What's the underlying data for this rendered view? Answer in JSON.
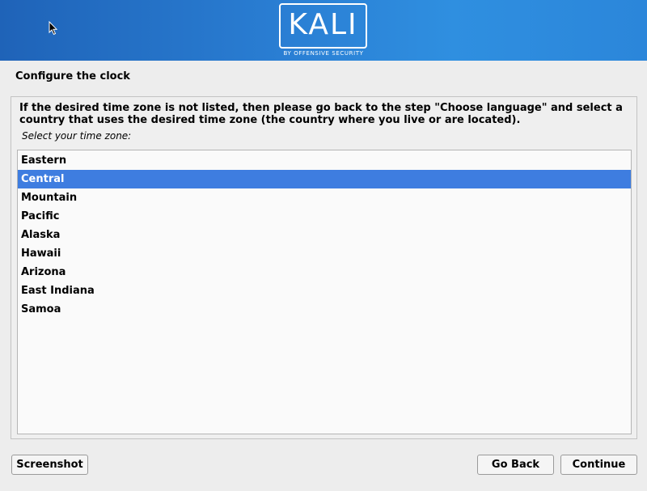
{
  "banner": {
    "logo_text": "KALI",
    "logo_subtext": "BY OFFENSIVE SECURITY"
  },
  "page_title": "Configure the clock",
  "description": "If the desired time zone is not listed, then please go back to the step \"Choose language\" and select a country that uses the desired time zone (the country where you live or are located).",
  "prompt": "Select your time zone:",
  "timezones": [
    {
      "label": "Eastern",
      "selected": false
    },
    {
      "label": "Central",
      "selected": true
    },
    {
      "label": "Mountain",
      "selected": false
    },
    {
      "label": "Pacific",
      "selected": false
    },
    {
      "label": "Alaska",
      "selected": false
    },
    {
      "label": "Hawaii",
      "selected": false
    },
    {
      "label": "Arizona",
      "selected": false
    },
    {
      "label": "East Indiana",
      "selected": false
    },
    {
      "label": "Samoa",
      "selected": false
    }
  ],
  "buttons": {
    "screenshot": "Screenshot",
    "go_back": "Go Back",
    "continue": "Continue"
  },
  "colors": {
    "selection": "#3e7de0",
    "banner": "#2a7fd4"
  }
}
